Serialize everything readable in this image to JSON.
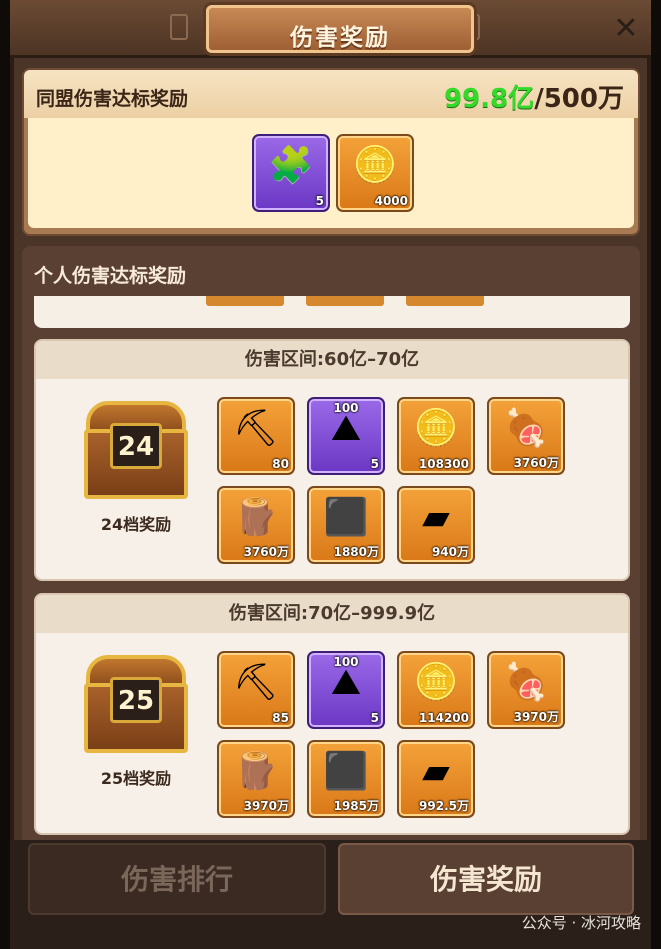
{
  "title": "伤害奖励",
  "close_icon": "close-icon",
  "alliance": {
    "label": "同盟伤害达标奖励",
    "progress_current": "99.8亿",
    "progress_target": "/500万",
    "rewards": [
      {
        "icon": "hero-puzzle-icon",
        "qty": "5",
        "epic": true
      },
      {
        "icon": "gold-coin-icon",
        "qty": "4000",
        "epic": false
      }
    ]
  },
  "personal": {
    "label": "个人伤害达标奖励",
    "tiers": [
      {
        "range": "伤害区间:60亿–70亿",
        "chest_num": "24",
        "tier_label": "24档奖励",
        "items": [
          {
            "icon": "ore-pickaxe-icon",
            "qty": "80"
          },
          {
            "icon": "mountain-ore-icon",
            "qty": "5",
            "top": "100",
            "epic": true
          },
          {
            "icon": "gold-coin-icon",
            "qty": "108300"
          },
          {
            "icon": "meat-icon",
            "qty": "3760万"
          },
          {
            "icon": "wood-logs-icon",
            "qty": "3760万"
          },
          {
            "icon": "coal-icon",
            "qty": "1880万"
          },
          {
            "icon": "iron-ingot-icon",
            "qty": "940万"
          }
        ]
      },
      {
        "range": "伤害区间:70亿–999.9亿",
        "chest_num": "25",
        "tier_label": "25档奖励",
        "items": [
          {
            "icon": "ore-pickaxe-icon",
            "qty": "85"
          },
          {
            "icon": "mountain-ore-icon",
            "qty": "5",
            "top": "100",
            "epic": true
          },
          {
            "icon": "gold-coin-icon",
            "qty": "114200"
          },
          {
            "icon": "meat-icon",
            "qty": "3970万"
          },
          {
            "icon": "wood-logs-icon",
            "qty": "3970万"
          },
          {
            "icon": "coal-icon",
            "qty": "1985万"
          },
          {
            "icon": "iron-ingot-icon",
            "qty": "992.5万"
          }
        ]
      }
    ]
  },
  "tabs": {
    "rank": "伤害排行",
    "reward": "伤害奖励"
  },
  "watermark": "公众号 · 冰河攻略",
  "colors": {
    "accent_green": "#35d92a",
    "item_orange": "#f4a23a",
    "item_purple": "#9a6ae8"
  }
}
